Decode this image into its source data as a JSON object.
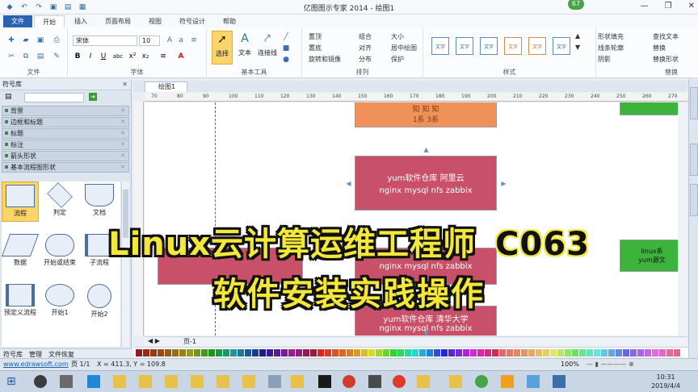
{
  "window": {
    "title": "亿图图示专家 2014 - 绘图1",
    "badge": "67",
    "controls": [
      "—",
      "❐",
      "✕"
    ]
  },
  "menu": {
    "tabs": [
      "文件",
      "开始",
      "插入",
      "页面布局",
      "视图",
      "符号设计",
      "帮助"
    ],
    "active": "开始"
  },
  "ribbon": {
    "groups": {
      "file": "文件",
      "font": "字体",
      "basic_tools": "基本工具",
      "arrange": "排列",
      "style": "样式",
      "replace": "替换"
    },
    "font_name": "宋体",
    "font_size": "10",
    "font_buttons": [
      "B",
      "I",
      "U",
      "abc",
      "x²",
      "x₂",
      "≡",
      "A"
    ],
    "tools": [
      "选择",
      "文本",
      "连接线"
    ],
    "arrange_items": [
      "置顶",
      "置底",
      "旋转和镜像",
      "组合",
      "对齐",
      "分布",
      "大小",
      "居中绘图",
      "保护"
    ],
    "style_label": "文字",
    "style_items": [
      "形状填充",
      "线条轮廓",
      "阴影"
    ],
    "replace_items": [
      "查找文本",
      "替换",
      "替换形状"
    ]
  },
  "left_panel": {
    "title": "符号库",
    "categories": [
      "背景",
      "边框和标题",
      "标题",
      "标注",
      "箭头形状",
      "基本流程图形状"
    ],
    "shapes": [
      "流程",
      "判定",
      "文档",
      "数据",
      "开始或结束",
      "子流程",
      "预定义流程",
      "开始1",
      "开始2"
    ],
    "bottom_tabs": [
      "符号库",
      "管理",
      "文件恢复"
    ]
  },
  "document": {
    "tab": "绘图1",
    "page_tab": "页-1",
    "ruler_marks": [
      "70",
      "80",
      "90",
      "100",
      "110",
      "120",
      "130",
      "140",
      "150",
      "160",
      "170",
      "180",
      "190",
      "200",
      "210",
      "220",
      "230",
      "240",
      "250",
      "260",
      "270"
    ]
  },
  "diagram": {
    "box_top_text": "1系  3系",
    "box_top_cut": "知 知 知",
    "box_main_line1": "yum软件仓库 阿里云",
    "box_main_line2": "nginx mysql nfs zabbix",
    "box_mid_line2": "nginx mysql nfs zabbix",
    "box_bottom_line1": "yum软件仓库 清华大学",
    "box_bottom_line2": "nginx mysql nfs zabbix",
    "box_right_line1": "linux系",
    "box_right_line2": "yum源文",
    "colors": {
      "orange": "#f0915a",
      "rose": "#c85068",
      "green": "#3cb43c"
    }
  },
  "status": {
    "website": "www.edrawsoft.com",
    "page": "页 1/1",
    "coords": "X = 411.3, Y = 109.8",
    "zoom": "100%"
  },
  "taskbar": {
    "time": "10:31",
    "date": "2019/4/4"
  },
  "overlay": {
    "line1": "Linux云计算运维工程师",
    "code": "C063",
    "line2": "软件安装实践操作"
  }
}
